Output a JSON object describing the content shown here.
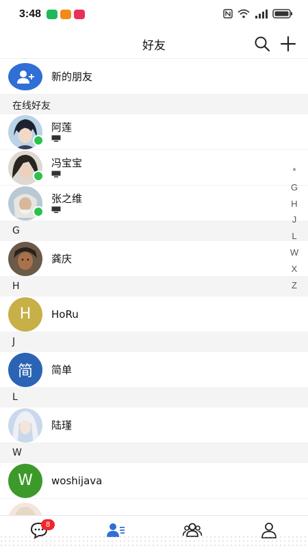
{
  "status_bar": {
    "time": "3:48"
  },
  "header": {
    "title": "好友"
  },
  "new_friend": {
    "label": "新的朋友"
  },
  "online_section": {
    "title": "在线好友",
    "friends": [
      {
        "name": "阿莲"
      },
      {
        "name": "冯宝宝"
      },
      {
        "name": "张之维"
      }
    ]
  },
  "groups": [
    {
      "letter": "G",
      "contacts": [
        {
          "name": "龚庆"
        }
      ]
    },
    {
      "letter": "H",
      "contacts": [
        {
          "name": "HoRu",
          "avatar_letter": "H"
        }
      ]
    },
    {
      "letter": "J",
      "contacts": [
        {
          "name": "简单",
          "avatar_letter": "简"
        }
      ]
    },
    {
      "letter": "L",
      "contacts": [
        {
          "name": "陆瑾"
        }
      ]
    },
    {
      "letter": "W",
      "contacts": [
        {
          "name": "woshijava",
          "avatar_letter": "W"
        }
      ]
    }
  ],
  "index_bar": [
    "*",
    "G",
    "H",
    "J",
    "L",
    "W",
    "X",
    "Z"
  ],
  "tabbar": {
    "messages_badge": "8"
  },
  "colors": {
    "accent_blue": "#2f6fd6",
    "online_green": "#2bc14a",
    "h_avatar": "#c6b047",
    "j_avatar": "#2b64b4",
    "w_avatar": "#3c9a2a",
    "badge_red": "#f0252a"
  },
  "icons": {
    "search": "search-icon",
    "add": "plus-icon",
    "new_friend": "add-user-icon",
    "tab_messages": "chat-bubble-icon",
    "tab_contacts": "contacts-icon",
    "tab_groups": "group-icon",
    "tab_profile": "profile-icon"
  }
}
